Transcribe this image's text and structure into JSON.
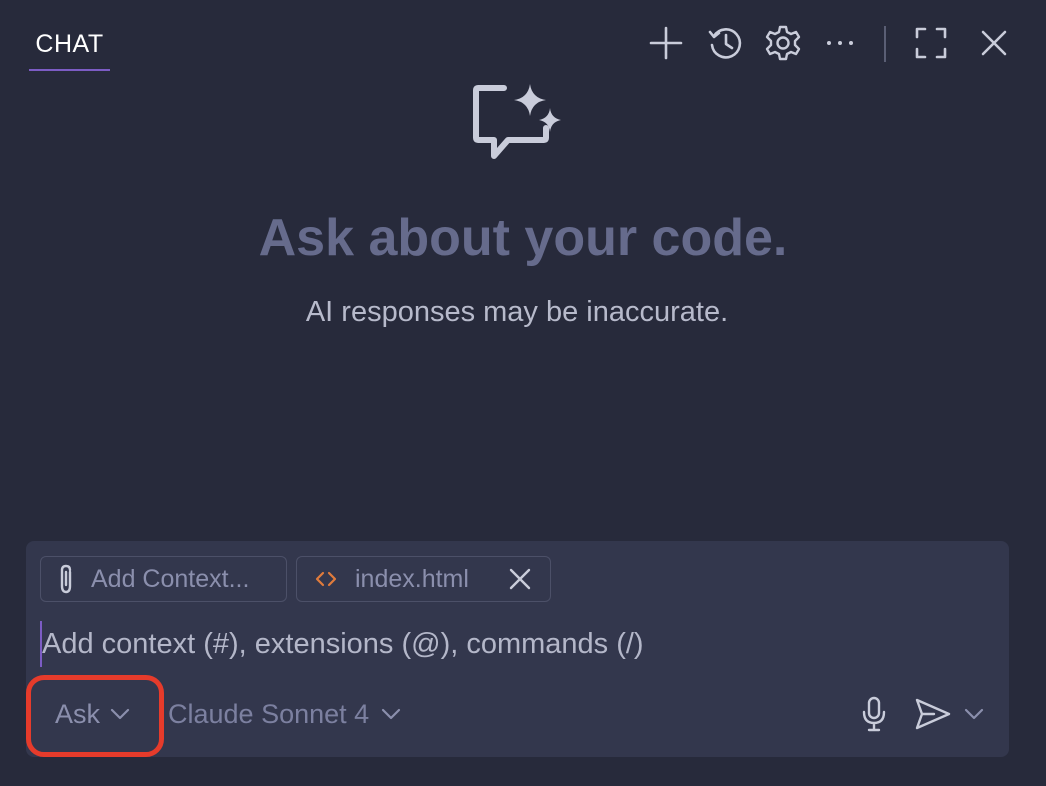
{
  "header": {
    "tab_label": "CHAT",
    "actions": [
      {
        "name": "new-chat",
        "icon": "plus-icon"
      },
      {
        "name": "history",
        "icon": "history-icon"
      },
      {
        "name": "settings",
        "icon": "gear-icon"
      },
      {
        "name": "more",
        "icon": "ellipsis-icon"
      },
      {
        "name": "maximize",
        "icon": "maximize-icon"
      },
      {
        "name": "close",
        "icon": "close-icon"
      }
    ]
  },
  "empty_state": {
    "icon": "chat-sparkle-icon",
    "title": "Ask about your code.",
    "subtitle": "AI responses may be inaccurate."
  },
  "input": {
    "add_context_label": "Add Context...",
    "attached_file": "index.html",
    "placeholder": "Add context (#), extensions (@), commands (/)",
    "mode": "Ask",
    "model": "Claude Sonnet 4"
  },
  "colors": {
    "background": "#272a3b",
    "input_background": "#33374d",
    "accent": "#7c5cc4",
    "highlight": "#e63b2b",
    "file_icon": "#e07b3c"
  }
}
